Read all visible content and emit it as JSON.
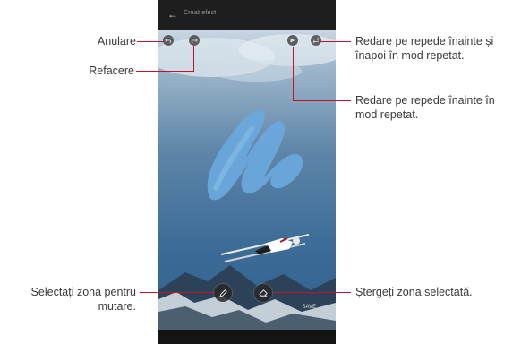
{
  "app": {
    "back_icon": "back-arrow-icon",
    "title": "Creat efect"
  },
  "canvas": {
    "save_label": "SAVE"
  },
  "controls": {
    "undo_icon": "undo-icon",
    "redo_icon": "redo-icon",
    "play_icon": "play-forward-icon",
    "repeat_icon": "repeat-icon",
    "select_icon": "pencil-icon",
    "erase_icon": "eraser-icon"
  },
  "callouts": {
    "undo": "Anulare",
    "redo": "Refacere",
    "repeat_line1": "Redare pe repede înainte și",
    "repeat_line2": "înapoi în mod repetat.",
    "forward_line1": "Redare pe repede înainte în",
    "forward_line2": "mod repetat.",
    "select_line1": "Selectați zona pentru",
    "select_line2": "mutare.",
    "erase": "Ștergeți zona selectată."
  },
  "colors": {
    "accent": "#c8102e",
    "sky": "#5f86a9",
    "paint": "#6aa8dc"
  }
}
